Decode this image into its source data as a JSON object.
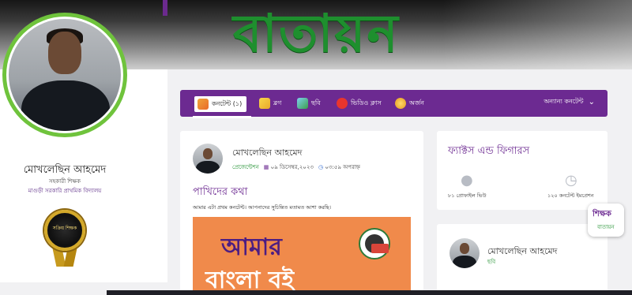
{
  "banner": {
    "title": "বাতায়ন"
  },
  "profile": {
    "name": "মোখলেছিন আহমেদ",
    "role": "সহকারী শিক্ষক",
    "school": "মাগুড়ী সরকারি প্রাথমিক বিদ্যালয়",
    "badge_label": "সক্রিয় শিক্ষক"
  },
  "nav": {
    "items": [
      {
        "label": "কনটেন্ট (১)",
        "icon": "content-icon",
        "color": "#f0a43a"
      },
      {
        "label": "ব্লগ",
        "icon": "blog-icon",
        "color": "#f2c23a"
      },
      {
        "label": "ছবি",
        "icon": "image-icon",
        "color": "#3ab0e0"
      },
      {
        "label": "ভিডিও ক্লাস",
        "icon": "video-icon",
        "color": "#e8352e"
      },
      {
        "label": "অর্জন",
        "icon": "medal-icon",
        "color": "#f0a43a"
      }
    ],
    "dropdown_label": "অন্যান্য কনটেন্ট"
  },
  "post": {
    "author": "মোখলেছিন আহমেদ",
    "category": "প্রেজেন্টেশন",
    "date": "০৯ ডিসেম্বর,২০২৩",
    "time": "০৩:৫৯ অপরাহ্ন",
    "title": "পাখিদের কথা",
    "excerpt": "আমার এটা প্রথম কনটেন্ট। আপনাদের সুচিন্তিত মতামত আশা করছি।",
    "image_line1": "আমার",
    "image_line2": "বাংলা বই"
  },
  "facts": {
    "title": "ফ্যাক্টস এন্ড ফিগারস",
    "profile_views": "৮১ প্রোফাইল ভিউ",
    "content_impressions": "১২০ কনটেন্ট ইমপ্রেশন"
  },
  "author_card": {
    "name": "মোখলেছিন আহমেদ",
    "sub": "ছবি"
  },
  "float_badge": {
    "line1": "শিক্ষক",
    "line2": "বাতায়ন"
  },
  "colors": {
    "brand_purple": "#6c2a91",
    "brand_green": "#1e8f2e",
    "avatar_ring": "#6fc33c"
  }
}
